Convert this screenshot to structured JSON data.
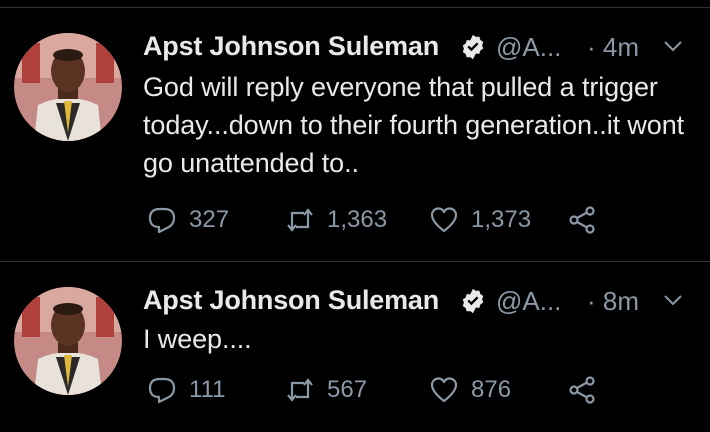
{
  "colors": {
    "background": "#000000",
    "text": "#e7e9ea",
    "secondary": "#8b98a5",
    "divider": "#2f3336",
    "verified": "#e7e9ea"
  },
  "tweets": [
    {
      "author_name": "Apst Johnson Suleman",
      "handle": "@A...",
      "time": "· 4m",
      "text": "God will reply everyone that pulled a trigger today...down to their fourth generation..it wont go unattended to..",
      "replies": "327",
      "retweets": "1,363",
      "likes": "1,373",
      "icons": [
        "reply-icon",
        "retweet-icon",
        "like-icon",
        "share-icon"
      ]
    },
    {
      "author_name": "Apst Johnson Suleman",
      "handle": "@A...",
      "time": "· 8m",
      "text": "I weep....",
      "replies": "111",
      "retweets": "567",
      "likes": "876",
      "icons": [
        "reply-icon",
        "retweet-icon",
        "like-icon",
        "share-icon"
      ]
    }
  ]
}
